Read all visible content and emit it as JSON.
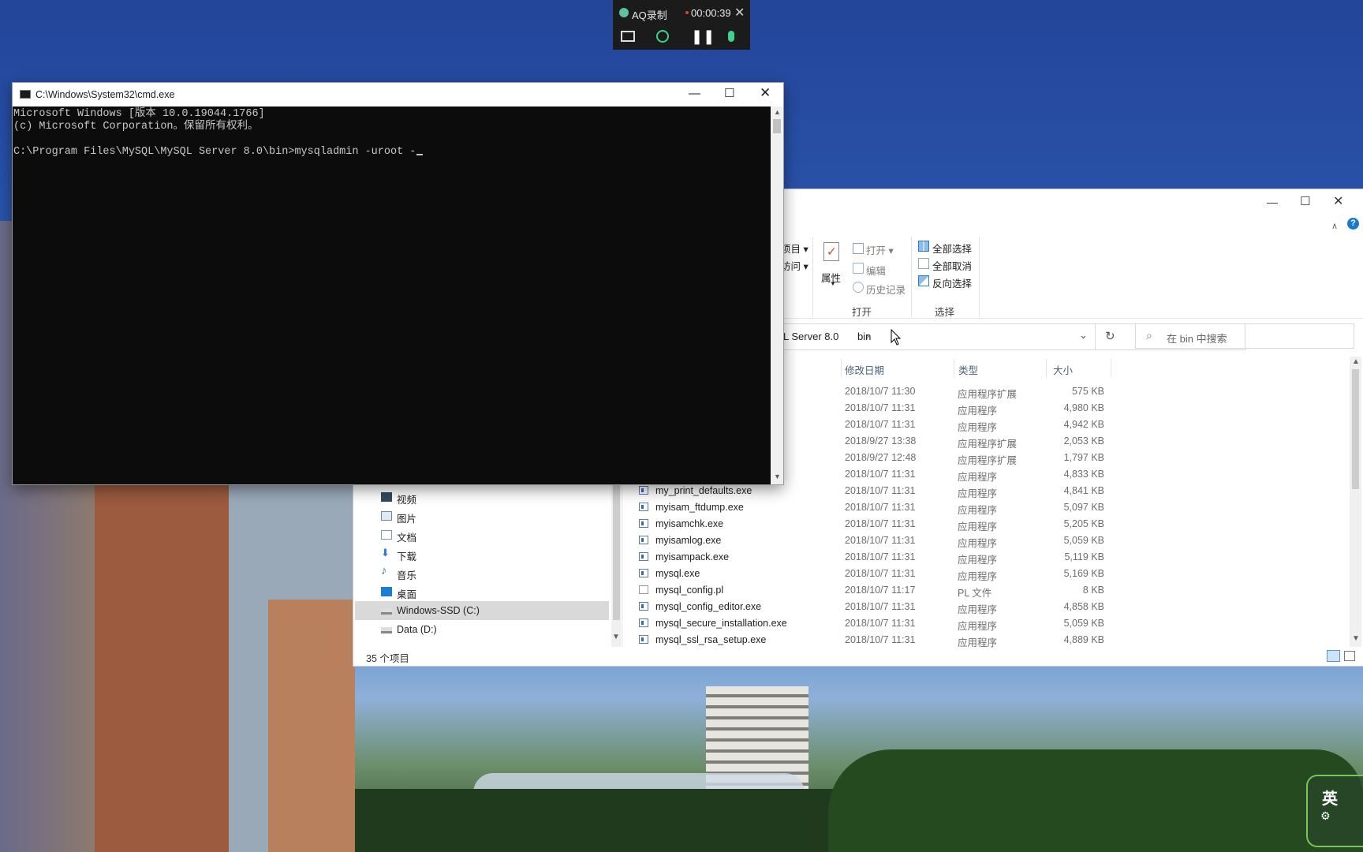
{
  "recorder": {
    "app_name": "AQ录制",
    "elapsed": "00:00:39"
  },
  "cmd": {
    "title": "C:\\Windows\\System32\\cmd.exe",
    "lines": [
      "Microsoft Windows [版本 10.0.19044.1766]",
      "(c) Microsoft Corporation。保留所有权利。",
      "",
      "C:\\Program Files\\MySQL\\MySQL Server 8.0\\bin>mysqladmin -uroot -"
    ]
  },
  "explorer": {
    "ribbon": {
      "partial_top": "项目",
      "partial_bottom": "访问",
      "properties": "属性",
      "open": "打开",
      "edit": "编辑",
      "history": "历史记录",
      "group_open": "打开",
      "select_all": "全部选择",
      "select_none": "全部取消",
      "invert_selection": "反向选择",
      "group_select": "选择"
    },
    "address": {
      "crumb_partial": "L Server 8.0",
      "separator": "›",
      "crumb_current": "bin"
    },
    "search_placeholder": "在 bin 中搜索",
    "columns": {
      "modified": "修改日期",
      "type": "类型",
      "size": "大小"
    },
    "nav": [
      {
        "label": "视频",
        "icon": "video-icon"
      },
      {
        "label": "图片",
        "icon": "picture-icon"
      },
      {
        "label": "文档",
        "icon": "document-icon"
      },
      {
        "label": "下载",
        "icon": "download-icon"
      },
      {
        "label": "音乐",
        "icon": "music-icon"
      },
      {
        "label": "桌面",
        "icon": "desktop-icon"
      },
      {
        "label": "Windows-SSD (C:)",
        "icon": "drive-icon",
        "selected": true
      },
      {
        "label": "Data (D:)",
        "icon": "drive-icon"
      }
    ],
    "files": [
      {
        "name": "",
        "date": "2018/10/7 11:30",
        "type": "应用程序扩展",
        "size": "575 KB"
      },
      {
        "name": "",
        "date": "2018/10/7 11:31",
        "type": "应用程序",
        "size": "4,980 KB"
      },
      {
        "name": "",
        "date": "2018/10/7 11:31",
        "type": "应用程序",
        "size": "4,942 KB"
      },
      {
        "name": "",
        "date": "2018/9/27 13:38",
        "type": "应用程序扩展",
        "size": "2,053 KB"
      },
      {
        "name": "",
        "date": "2018/9/27 12:48",
        "type": "应用程序扩展",
        "size": "1,797 KB"
      },
      {
        "name": "",
        "date": "2018/10/7 11:31",
        "type": "应用程序",
        "size": "4,833 KB"
      },
      {
        "name": "my_print_defaults.exe",
        "date": "2018/10/7 11:31",
        "type": "应用程序",
        "size": "4,841 KB"
      },
      {
        "name": "myisam_ftdump.exe",
        "date": "2018/10/7 11:31",
        "type": "应用程序",
        "size": "5,097 KB"
      },
      {
        "name": "myisamchk.exe",
        "date": "2018/10/7 11:31",
        "type": "应用程序",
        "size": "5,205 KB"
      },
      {
        "name": "myisamlog.exe",
        "date": "2018/10/7 11:31",
        "type": "应用程序",
        "size": "5,059 KB"
      },
      {
        "name": "myisampack.exe",
        "date": "2018/10/7 11:31",
        "type": "应用程序",
        "size": "5,119 KB"
      },
      {
        "name": "mysql.exe",
        "date": "2018/10/7 11:31",
        "type": "应用程序",
        "size": "5,169 KB"
      },
      {
        "name": "mysql_config.pl",
        "date": "2018/10/7 11:17",
        "type": "PL 文件",
        "size": "8 KB"
      },
      {
        "name": "mysql_config_editor.exe",
        "date": "2018/10/7 11:31",
        "type": "应用程序",
        "size": "4,858 KB"
      },
      {
        "name": "mysql_secure_installation.exe",
        "date": "2018/10/7 11:31",
        "type": "应用程序",
        "size": "5,059 KB"
      },
      {
        "name": "mysql_ssl_rsa_setup.exe",
        "date": "2018/10/7 11:31",
        "type": "应用程序",
        "size": "4,889 KB"
      }
    ],
    "status": "35 个项目"
  },
  "ime": {
    "label": "英"
  }
}
